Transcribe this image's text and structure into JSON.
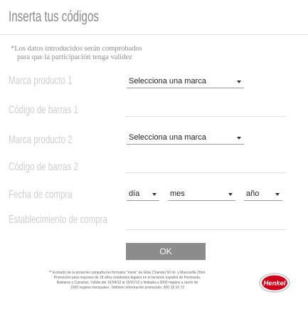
{
  "page": {
    "title": "Inserta tus códigos",
    "note_line1": "*Los datos introducidos serán comprobados",
    "note_line2": "para que la participación tenga validez"
  },
  "form": {
    "brand1_label": "Marca producto 1",
    "brand1_select": "Selecciona una marca",
    "barcode1_label": "Código de barras 1",
    "brand2_label": "Marca producto 2",
    "brand2_select": "Selecciona una marca",
    "barcode2_label": "Código de barras 2",
    "date_label": "Fecha de compra",
    "day_select": "día",
    "month_select": "mes",
    "year_select": "año",
    "store_label": "Establecimiento de compra",
    "ok_label": "OK"
  },
  "legal": {
    "line1": "** Excluido de la presente campaña los formatos \"minis\" de Gliss Champú 50 ml. y Mascarilla 20ml.",
    "line2": "Promoción para mayores de 18 años residentes legales en el territorio español de Península,",
    "line3": "Baleares y Canarias. Válida del 16/04/12 al 15/07/12 y limitada a 3000 regalos a razón de",
    "line4": "1000 regalos mensuales. Teléfono información promoción: 900 18 16 73"
  },
  "logo": {
    "text": "Henkel",
    "color": "#d0021b"
  }
}
